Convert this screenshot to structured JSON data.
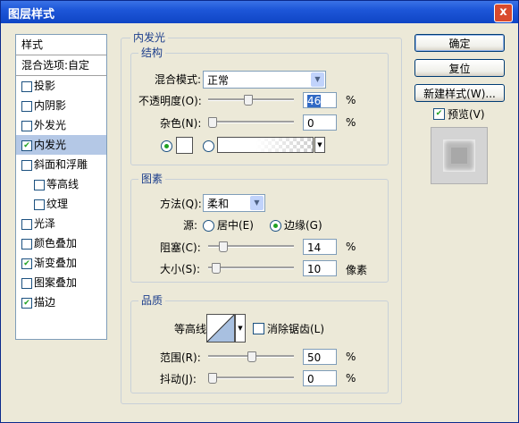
{
  "window": {
    "title": "图层样式",
    "close_glyph": "x"
  },
  "sidebar": {
    "header": "样式",
    "blend_options": "混合选项:自定",
    "items": [
      {
        "label": "投影",
        "checked": false
      },
      {
        "label": "内阴影",
        "checked": false
      },
      {
        "label": "外发光",
        "checked": false
      },
      {
        "label": "内发光",
        "checked": true,
        "selected": true
      },
      {
        "label": "斜面和浮雕",
        "checked": false
      },
      {
        "label": "等高线",
        "checked": false,
        "indent": true
      },
      {
        "label": "纹理",
        "checked": false,
        "indent": true
      },
      {
        "label": "光泽",
        "checked": false
      },
      {
        "label": "颜色叠加",
        "checked": false
      },
      {
        "label": "渐变叠加",
        "checked": true
      },
      {
        "label": "图案叠加",
        "checked": false
      },
      {
        "label": "描边",
        "checked": true
      }
    ]
  },
  "inner_glow": {
    "title": "内发光",
    "structure": {
      "title": "结构",
      "blend_mode_label": "混合模式:",
      "blend_mode_value": "正常",
      "opacity_label": "不透明度(O):",
      "opacity_value": "46",
      "opacity_fraction": 0.46,
      "noise_label": "杂色(N):",
      "noise_value": "0",
      "noise_fraction": 0.0,
      "percent": "%"
    },
    "elements": {
      "title": "图素",
      "technique_label": "方法(Q):",
      "technique_value": "柔和",
      "source_label": "源:",
      "source_center": "居中(E)",
      "source_edge": "边缘(G)",
      "choke_label": "阻塞(C):",
      "choke_value": "14",
      "choke_fraction": 0.14,
      "size_label": "大小(S):",
      "size_value": "10",
      "size_unit": "像素",
      "percent": "%"
    },
    "quality": {
      "title": "品质",
      "contour_label": "等高线:",
      "antialias_label": "消除锯齿(L)",
      "range_label": "范围(R):",
      "range_value": "50",
      "range_fraction": 0.5,
      "jitter_label": "抖动(J):",
      "jitter_value": "0",
      "jitter_fraction": 0.0,
      "percent": "%"
    }
  },
  "buttons": {
    "ok": "确定",
    "reset": "复位",
    "new_style": "新建样式(W)...",
    "preview": "预览(V)"
  }
}
